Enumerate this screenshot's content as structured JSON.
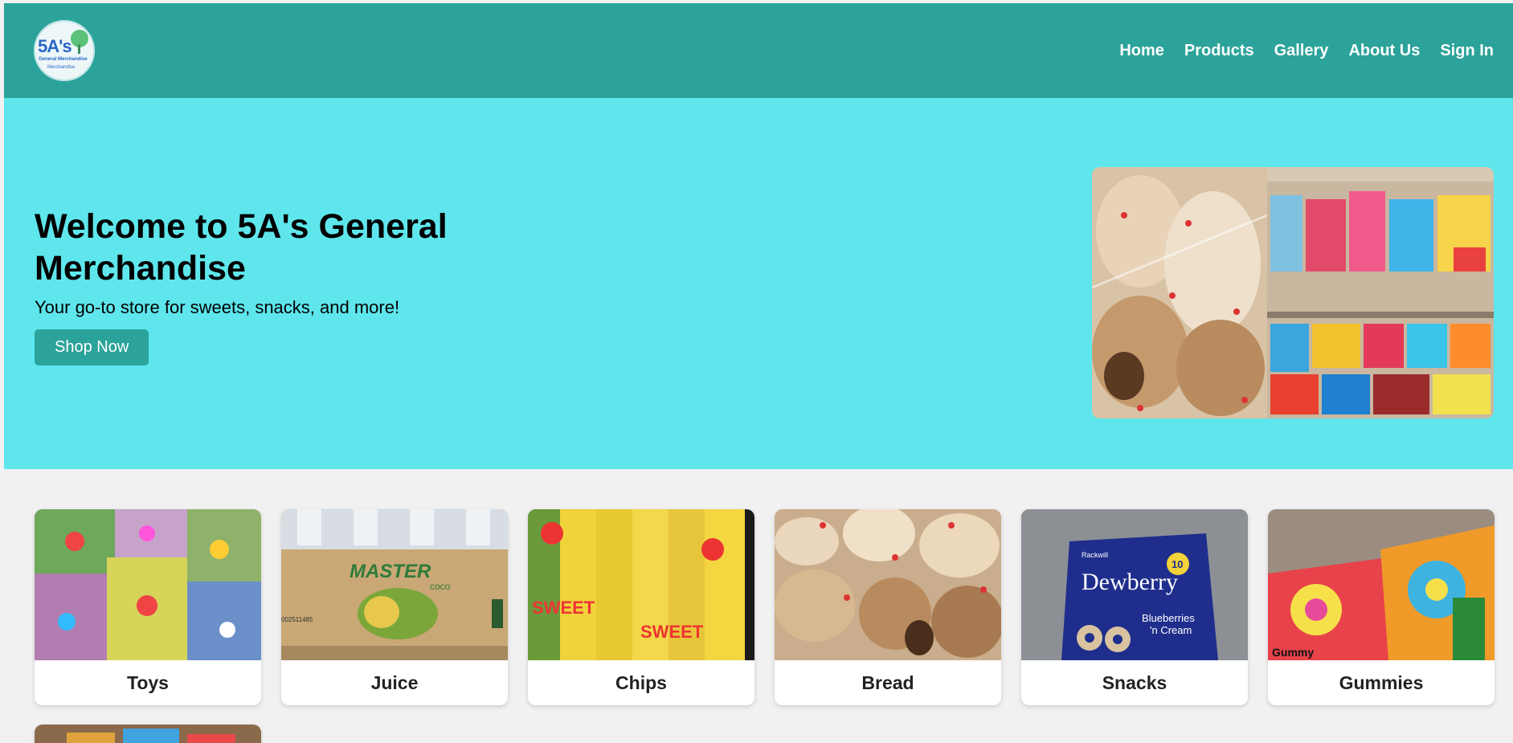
{
  "header": {
    "logo": {
      "line1": "5A's",
      "line2": "General Merchandise",
      "line3": "Merchandise"
    },
    "nav": [
      "Home",
      "Products",
      "Gallery",
      "About Us",
      "Sign In"
    ],
    "color": "#2ba39a"
  },
  "hero": {
    "title": "Welcome to 5A's General Merchandise",
    "subtitle": "Your go-to store for sweets, snacks, and more!",
    "button": "Shop Now",
    "background": "#5ee6ec"
  },
  "categories": [
    {
      "label": "Toys"
    },
    {
      "label": "Juice"
    },
    {
      "label": "Chips"
    },
    {
      "label": "Bread"
    },
    {
      "label": "Snacks"
    },
    {
      "label": "Gummies"
    }
  ],
  "images": {
    "juice_box_text": "MASTER",
    "juice_box_sub": "coco",
    "juice_barcode": "002511485",
    "chips_text": "SWEET",
    "snacks_brand": "Dewberry",
    "snacks_flavor1": "Blueberries",
    "snacks_flavor2": "'n Cream",
    "snacks_maker": "Rackwill",
    "snacks_badge": "10",
    "gummies_text": "Gummy"
  }
}
